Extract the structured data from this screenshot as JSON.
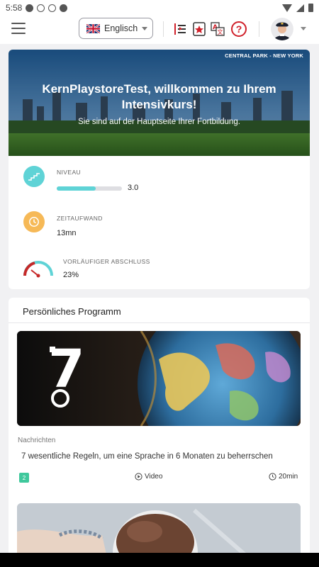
{
  "status_bar": {
    "time": "5:58"
  },
  "header": {
    "language_label": "Englisch"
  },
  "hero": {
    "location": "CENTRAL PARK - NEW YORK",
    "title": "KernPlaystoreTest, willkommen zu Ihrem Intensivkurs!",
    "subtitle": "Sie sind auf der Hauptseite Ihrer Fortbildung."
  },
  "stats": {
    "level": {
      "label": "NIVEAU",
      "value": "3.0",
      "progress_fraction": 0.6
    },
    "time": {
      "label": "ZEITAUFWAND",
      "value": "13mn"
    },
    "completion": {
      "label": "VORLÄUFIGER ABSCHLUSS",
      "value": "23%"
    }
  },
  "program": {
    "heading": "Persönliches Programm",
    "items": [
      {
        "image_text": "7",
        "category": "Nachrichten",
        "title": "7 wesentliche Regeln, um eine Sprache in 6 Monaten zu beherrschen",
        "badge": "2",
        "type": "Video",
        "duration": "20min"
      }
    ]
  },
  "colors": {
    "accent_teal": "#5fd3d6",
    "clock_orange": "#f6b957",
    "help_red": "#d0202a",
    "badge_green": "#3fc89c"
  }
}
